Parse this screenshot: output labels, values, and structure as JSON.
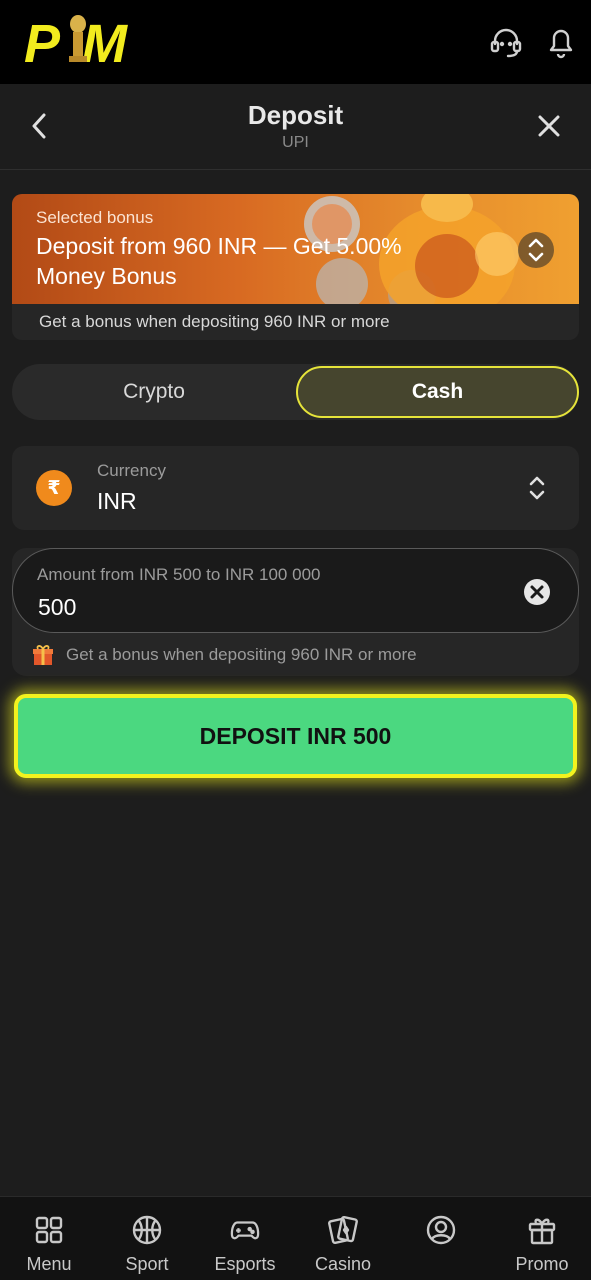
{
  "brand": {
    "logo_text": "PM",
    "accent": "#f2f21e"
  },
  "header": {
    "title": "Deposit",
    "subtitle": "UPI"
  },
  "bonus": {
    "label": "Selected bonus",
    "title": "Deposit from 960 INR — Get 5.00% Money Bonus",
    "note": "Get a bonus when depositing 960 INR or more"
  },
  "segment": {
    "options": [
      "Crypto",
      "Cash"
    ],
    "selected": "Cash"
  },
  "currency": {
    "label": "Currency",
    "value": "INR",
    "symbol": "₹"
  },
  "amount": {
    "label": "Amount from INR 500 to INR 100 000",
    "value": "500",
    "note": "Get a bonus when depositing 960 INR or more"
  },
  "deposit_button": {
    "label": "DEPOSIT INR 500",
    "color": "#4bd880"
  },
  "bottom_nav": {
    "items": [
      {
        "label": "Menu",
        "icon": "grid-icon"
      },
      {
        "label": "Sport",
        "icon": "basketball-icon"
      },
      {
        "label": "Esports",
        "icon": "gamepad-icon"
      },
      {
        "label": "Casino",
        "icon": "cards-icon"
      },
      {
        "label": "",
        "icon": "profile-icon"
      },
      {
        "label": "Promo",
        "icon": "gift-icon"
      }
    ]
  }
}
